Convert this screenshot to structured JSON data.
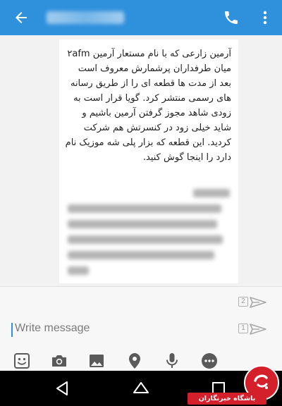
{
  "appbar": {
    "back_icon": "arrow-left-icon",
    "call_icon": "phone-icon",
    "more_icon": "more-vertical-icon",
    "background_color": "#2f90dc"
  },
  "message": {
    "text": "آرمین زارعی که با نام مستعار آرمین ۲afm میان طرفداران پرشمارش معروف است بعد از مدت ها قطعه ای را از طریق رسانه های رسمی منتشر کرد. گویا قرار است به زودی شاهد مجوز گرفتن آرمین باشیم و شاید خیلی زود در کنسرتش هم شرکت کردید. این قطعه که بزار پلی شه موزیک نام دارد را اینجا گوش کنید."
  },
  "composer": {
    "placeholder": "Write message",
    "sim2_label": "2",
    "sim1_label": "1",
    "tools": [
      "sticker-icon",
      "camera-icon",
      "image-icon",
      "location-icon",
      "microphone-icon",
      "more-horizontal-icon"
    ]
  },
  "navbar": {
    "buttons": [
      "back-triangle-icon",
      "home-circle-icon",
      "recents-square-icon"
    ]
  },
  "watermark": {
    "text": "باشگاه خبرنگاران"
  }
}
